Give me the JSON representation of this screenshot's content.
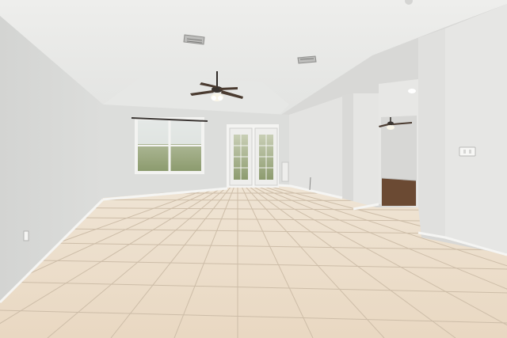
{
  "scene": {
    "description_tags": [
      "empty-room",
      "living-room",
      "tile-floor",
      "ceiling-fan",
      "french-doors",
      "vaulted-ceiling"
    ],
    "colors": {
      "ceiling": "#e9e9e7",
      "wall_left": "#d7d8d6",
      "wall_back": "#dfe0de",
      "wall_right": "#e4e4e2",
      "tile": "#ecdcc8",
      "tile_grout": "#cbb9a3",
      "baseboard": "#f4f4f2",
      "wood_floor": "#6b4a33",
      "door_frame": "#f2f2f0",
      "window_glass": "#a8b48a",
      "fan_body": "#3a3430"
    },
    "icons": [
      "ceiling-fan-icon",
      "air-vent-icon",
      "light-switch-icon",
      "window-icon",
      "french-door-icon"
    ]
  }
}
